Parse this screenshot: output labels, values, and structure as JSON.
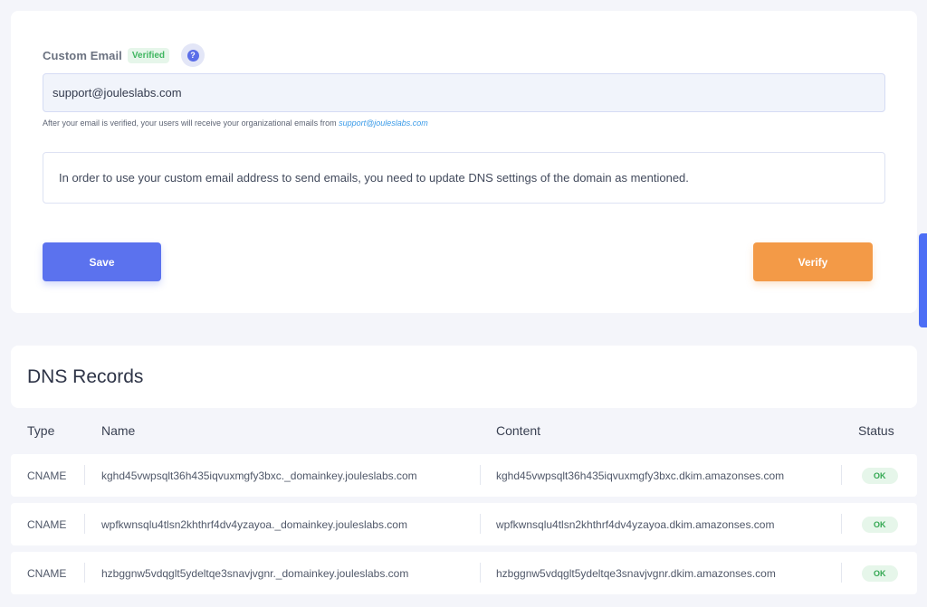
{
  "custom_email": {
    "label": "Custom Email",
    "badge": "Verified",
    "help_icon": "?",
    "value": "support@jouleslabs.com",
    "helper_prefix": "After your email is verified, your users will receive your organizational emails from ",
    "helper_link": "support@jouleslabs.com",
    "info": "In order to use your custom email address to send emails, you need to update DNS settings of the domain as mentioned.",
    "save_label": "Save",
    "verify_label": "Verify"
  },
  "dns": {
    "title": "DNS Records",
    "columns": {
      "type": "Type",
      "name": "Name",
      "content": "Content",
      "status": "Status"
    },
    "rows": [
      {
        "type": "CNAME",
        "name": "kghd45vwpsqlt36h435iqvuxmgfy3bxc._domainkey.jouleslabs.com",
        "content": "kghd45vwpsqlt36h435iqvuxmgfy3bxc.dkim.amazonses.com",
        "status": "OK"
      },
      {
        "type": "CNAME",
        "name": "wpfkwnsqlu4tlsn2khthrf4dv4yzayoa._domainkey.jouleslabs.com",
        "content": "wpfkwnsqlu4tlsn2khthrf4dv4yzayoa.dkim.amazonses.com",
        "status": "OK"
      },
      {
        "type": "CNAME",
        "name": "hzbggnw5vdqglt5ydeltqe3snavjvgnr._domainkey.jouleslabs.com",
        "content": "hzbggnw5vdqglt5ydeltqe3snavjvgnr.dkim.amazonses.com",
        "status": "OK"
      }
    ]
  },
  "colors": {
    "primary": "#5b72ee",
    "verify": "#f39a47",
    "success": "#34a853",
    "link": "#3b9be8"
  }
}
